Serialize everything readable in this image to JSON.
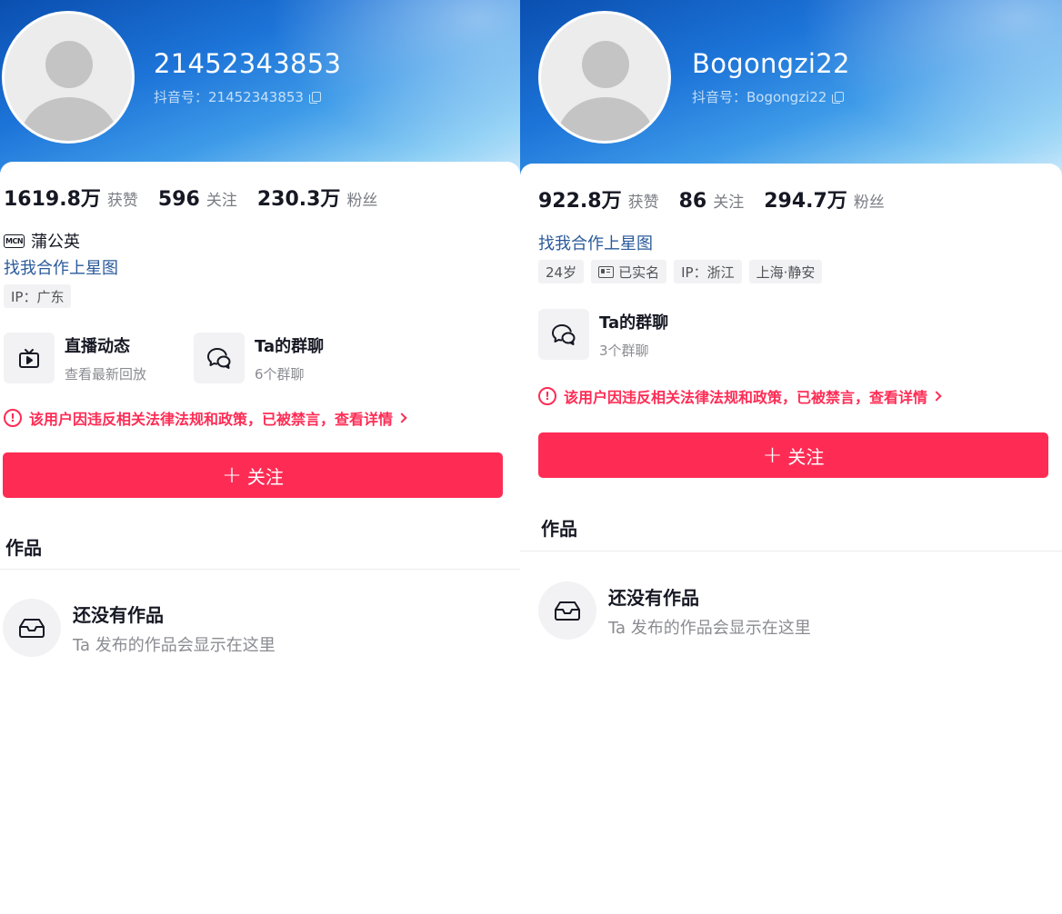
{
  "left": {
    "nickname": "21452343853",
    "douyin_id": "抖音号：21452343853",
    "stats": [
      {
        "value": "1619.8万",
        "label": "获赞"
      },
      {
        "value": "596",
        "label": "关注"
      },
      {
        "value": "230.3万",
        "label": "粉丝"
      }
    ],
    "mcn_badge": "MCN",
    "mcn_name": "蒲公英",
    "star_link": "找我合作上星图",
    "tags": [
      "IP：广东"
    ],
    "features": [
      {
        "title": "直播动态",
        "subtitle": "查看最新回放",
        "icon": "tv-play-icon"
      },
      {
        "title": "Ta的群聊",
        "subtitle": "6个群聊",
        "icon": "chat-bubbles-icon"
      }
    ],
    "warning": "该用户因违反相关法律法规和政策，已被禁言，查看详情",
    "follow_button": "关注",
    "works_title": "作品",
    "empty_title": "还没有作品",
    "empty_subtitle": "Ta 发布的作品会显示在这里"
  },
  "right": {
    "nickname": "Bogongzi22",
    "douyin_id": "抖音号：Bogongzi22",
    "stats": [
      {
        "value": "922.8万",
        "label": "获赞"
      },
      {
        "value": "86",
        "label": "关注"
      },
      {
        "value": "294.7万",
        "label": "粉丝"
      }
    ],
    "star_link": "找我合作上星图",
    "tags": [
      "24岁",
      "已实名",
      "IP：浙江",
      "上海·静安"
    ],
    "features": [
      {
        "title": "Ta的群聊",
        "subtitle": "3个群聊",
        "icon": "chat-bubbles-icon"
      }
    ],
    "warning": "该用户因违反相关法律法规和政策，已被禁言，查看详情",
    "follow_button": "关注",
    "works_title": "作品",
    "empty_title": "还没有作品",
    "empty_subtitle": "Ta 发布的作品会显示在这里"
  },
  "colors": {
    "accent": "#fe2c55",
    "link": "#2a5a9b",
    "header_blue": "#1d74d8"
  }
}
